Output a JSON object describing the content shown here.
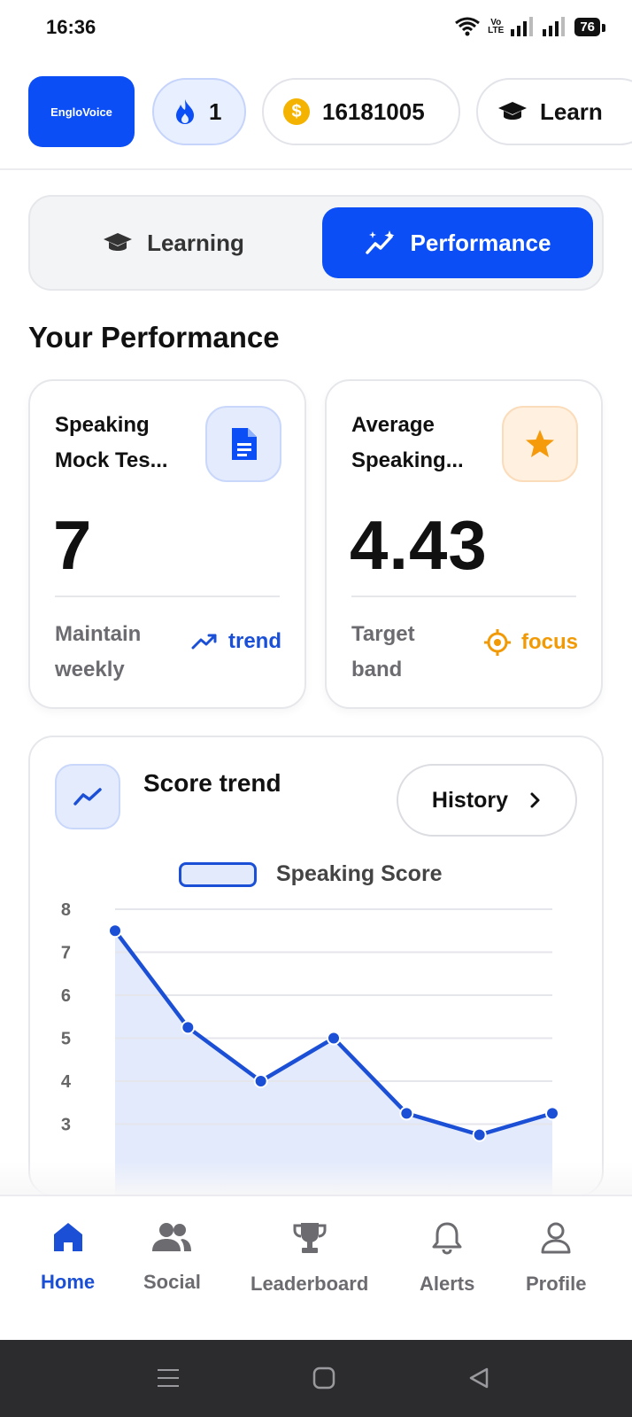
{
  "status_bar": {
    "time": "16:36",
    "volte_top": "Vo",
    "volte_bottom": "LTE",
    "battery": "76"
  },
  "header": {
    "logo_text": "EngloVoice",
    "streak_count": "1",
    "coins": "16181005",
    "learn_label": "Learn"
  },
  "segment": {
    "learning_label": "Learning",
    "performance_label": "Performance",
    "active": "performance"
  },
  "section_title": "Your Performance",
  "cards": [
    {
      "title": "Speaking Mock Tes...",
      "value": "7",
      "note": "Maintain weekly",
      "tag": "trend",
      "icon": "document-icon",
      "accent": "#1a4fd6"
    },
    {
      "title": "Average Speaking...",
      "value": "4.43",
      "note": "Target band",
      "tag": "focus",
      "icon": "star-icon",
      "accent": "#f19a06"
    }
  ],
  "trend": {
    "title": "Score trend",
    "history_label": "History"
  },
  "chart_data": {
    "type": "area",
    "series": [
      {
        "name": "Speaking Score",
        "values": [
          7.5,
          5.25,
          4.0,
          5.0,
          3.25,
          2.75,
          3.25
        ]
      }
    ],
    "x": [
      1,
      2,
      3,
      4,
      5,
      6,
      7
    ],
    "yticks": [
      3,
      4,
      5,
      6,
      7,
      8
    ],
    "ylim": [
      2.5,
      8
    ],
    "grid": true,
    "legend": "top-center",
    "color": "#1a4fd6"
  },
  "nav": {
    "items": [
      {
        "label": "Home",
        "icon": "home-icon",
        "active": true
      },
      {
        "label": "Social",
        "icon": "people-icon",
        "active": false
      },
      {
        "label": "Leaderboard",
        "icon": "trophy-icon",
        "active": false
      },
      {
        "label": "Alerts",
        "icon": "bell-icon",
        "active": false
      },
      {
        "label": "Profile",
        "icon": "person-icon",
        "active": false
      }
    ]
  },
  "colors": {
    "brand": "#0b4ef5",
    "accent_blue": "#1a4fd6",
    "accent_orange": "#f19a06",
    "coin": "#f5b301"
  }
}
